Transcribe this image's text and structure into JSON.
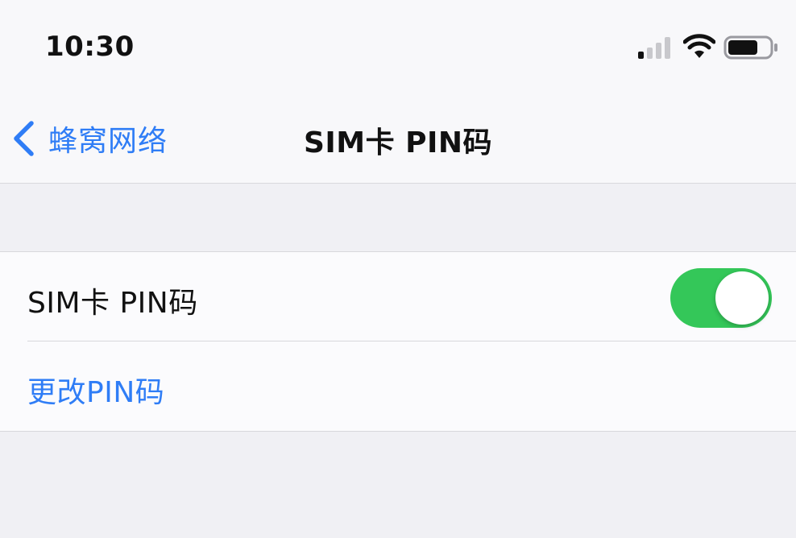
{
  "status_bar": {
    "time": "10:30",
    "signal_icon": "cellular-signal-icon",
    "wifi_icon": "wifi-icon",
    "battery_icon": "battery-icon"
  },
  "nav": {
    "back_label": "蜂窝网络",
    "back_icon": "chevron-left-icon",
    "title": "SIM卡 PIN码"
  },
  "settings": {
    "rows": [
      {
        "label": "SIM卡 PIN码",
        "control": "toggle",
        "toggle_on": true
      },
      {
        "label": "更改PIN码",
        "control": "link"
      }
    ]
  },
  "colors": {
    "accent": "#2f7df6",
    "toggle_on": "#34c759",
    "background": "#f2f2f7"
  }
}
